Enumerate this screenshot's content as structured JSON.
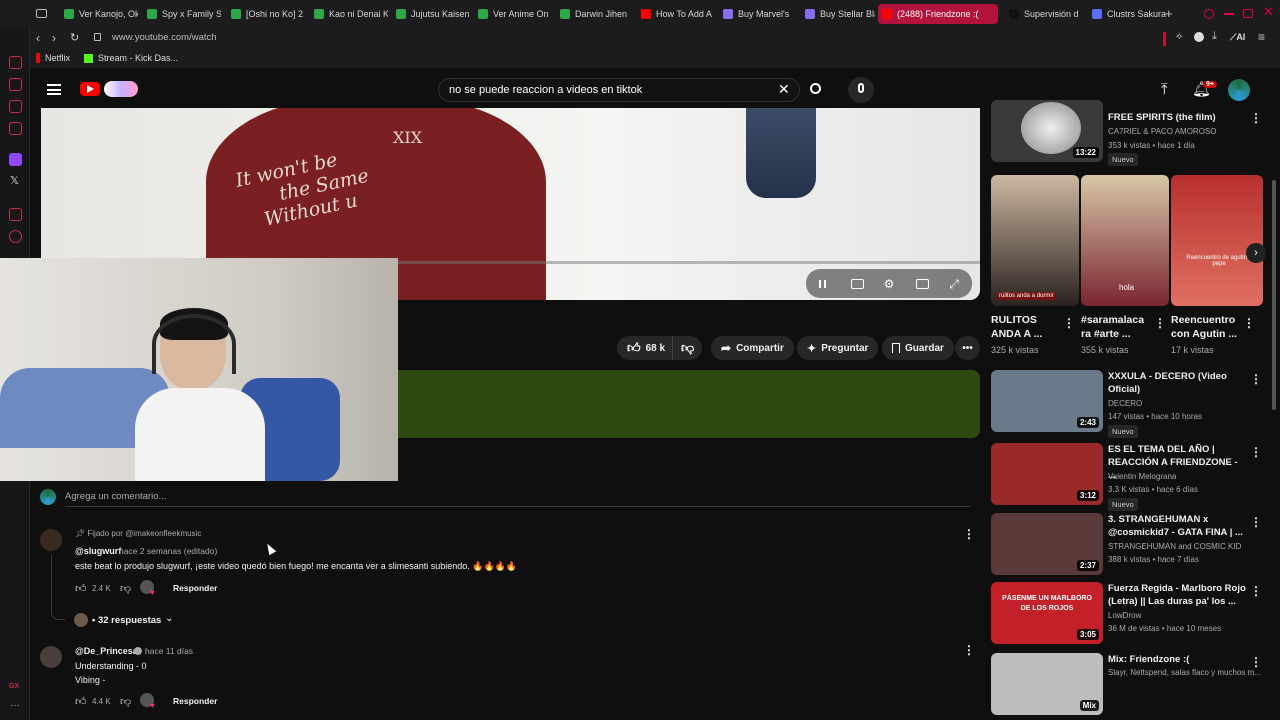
{
  "browser": {
    "tabs": [
      {
        "label": "Ver Kanojo, Ok",
        "color": "#2aa84a"
      },
      {
        "label": "Spy x Family S",
        "color": "#2aa84a"
      },
      {
        "label": "[Oshi no Ko] 2",
        "color": "#2aa84a"
      },
      {
        "label": "Kao ni Denai K",
        "color": "#2aa84a"
      },
      {
        "label": "Jujutsu Kaisen",
        "color": "#2aa84a"
      },
      {
        "label": "Ver Anime On",
        "color": "#2aa84a"
      },
      {
        "label": "Darwin Jihen",
        "color": "#2aa84a"
      },
      {
        "label": "How To Add A",
        "color": "#ff0000"
      },
      {
        "label": "Buy Marvel's",
        "color": "#8a6cf0"
      },
      {
        "label": "Buy Stellar Bla",
        "color": "#8a6cf0"
      },
      {
        "label": "(2488) Friendzone :(",
        "color": "#ff0000"
      },
      {
        "label": "Supervisión d",
        "color": "#111111"
      },
      {
        "label": "Clustrs Sakura",
        "color": "#5b6cff"
      }
    ],
    "url": "www.youtube.com/watch",
    "bookmarks": [
      "Netflix",
      "Stream - Kick Das..."
    ],
    "aria_label": "AI"
  },
  "youtube": {
    "search_query": "no se puede reaccion a videos en tiktok",
    "notifications_badge": "9+",
    "likes": "68 k",
    "share_label": "Compartir",
    "ask_label": "Preguntar",
    "save_label": "Guardar",
    "add_comment_placeholder": "Agrega un comentario...",
    "video_overlay_text": [
      "It won't be",
      "the Same",
      "Without u",
      "XIX"
    ]
  },
  "comments": [
    {
      "pinned": "Fijado por @imakeonfleekmusic",
      "author": "@slugwurf",
      "meta": "hace 2 semanas (editado)",
      "text": "este beat lo produjo slugwurf, ¡este video quedó bien fuego! me encanta ver a slimesanti subiendo. 🔥🔥🔥🔥",
      "likes": "2.4 K",
      "reply": "Responder",
      "replies": "• 32 respuestas"
    },
    {
      "author": "@De_Princesa",
      "meta": "hace 11 días",
      "text": "Understanding - 0",
      "text2": "Vibing -",
      "likes": "4.4 K",
      "reply": "Responder"
    }
  ],
  "sidebar": {
    "videos_top": [
      {
        "title": "FREE SPIRITS (the film)",
        "channel": "CA7RIEL & PACO AMOROSO",
        "stats": "353 k vistas • hace 1 día",
        "duration": "13:22",
        "badge": "Nuevo"
      }
    ],
    "shorts": [
      {
        "title": "RULITOS ANDA A ...",
        "views": "325 k vistas",
        "caption": "rulitos anda a dormir"
      },
      {
        "title": "#saramalaca ra #arte ...",
        "views": "355 k vistas",
        "caption": "hola"
      },
      {
        "title": "Reencuentro con Agutin ...",
        "views": "17 k vistas",
        "caption": "Reencuentro de agutin y pepe"
      }
    ],
    "videos": [
      {
        "title": "XXXULA - DECERO (Video Oficial)",
        "channel": "DECERO",
        "stats": "147 vistas • hace 10 horas",
        "duration": "2:43",
        "badge": "Nuevo",
        "thumb": "#6a7a8a"
      },
      {
        "title": "ES EL TEMA DEL AÑO | REACCIÓN A FRIENDZONE - ...",
        "channel": "Valentin Melograna",
        "stats": "3.3 K vistas • hace 6 días",
        "duration": "3:12",
        "badge": "Nuevo",
        "thumb": "#9a2a2a"
      },
      {
        "title": "3. STRANGEHUMAN x @cosmickid7 - GATA FINA | ...",
        "channel": "STRANGEHUMAN and COSMIC KID",
        "stats": "388 k vistas • hace 7 días",
        "duration": "2:37",
        "badge": "",
        "thumb": "#5a3a38"
      },
      {
        "title": "Fuerza Regida - Marlboro Rojo (Letra) || Las duras pa' los ...",
        "channel": "LowDrow",
        "stats": "36 M de vistas • hace 10 meses",
        "duration": "3:05",
        "badge": "",
        "thumb": "#c4202a",
        "overlay": "PÁSENME UN MARLBORO DE LOS ROJOS"
      },
      {
        "title": "Mix: Friendzone :(",
        "channel": "Slayr, Nettspend, salas flaco y muchos m...",
        "stats": "",
        "duration": "Mix",
        "badge": "",
        "thumb": "#bdbdbd"
      }
    ]
  }
}
